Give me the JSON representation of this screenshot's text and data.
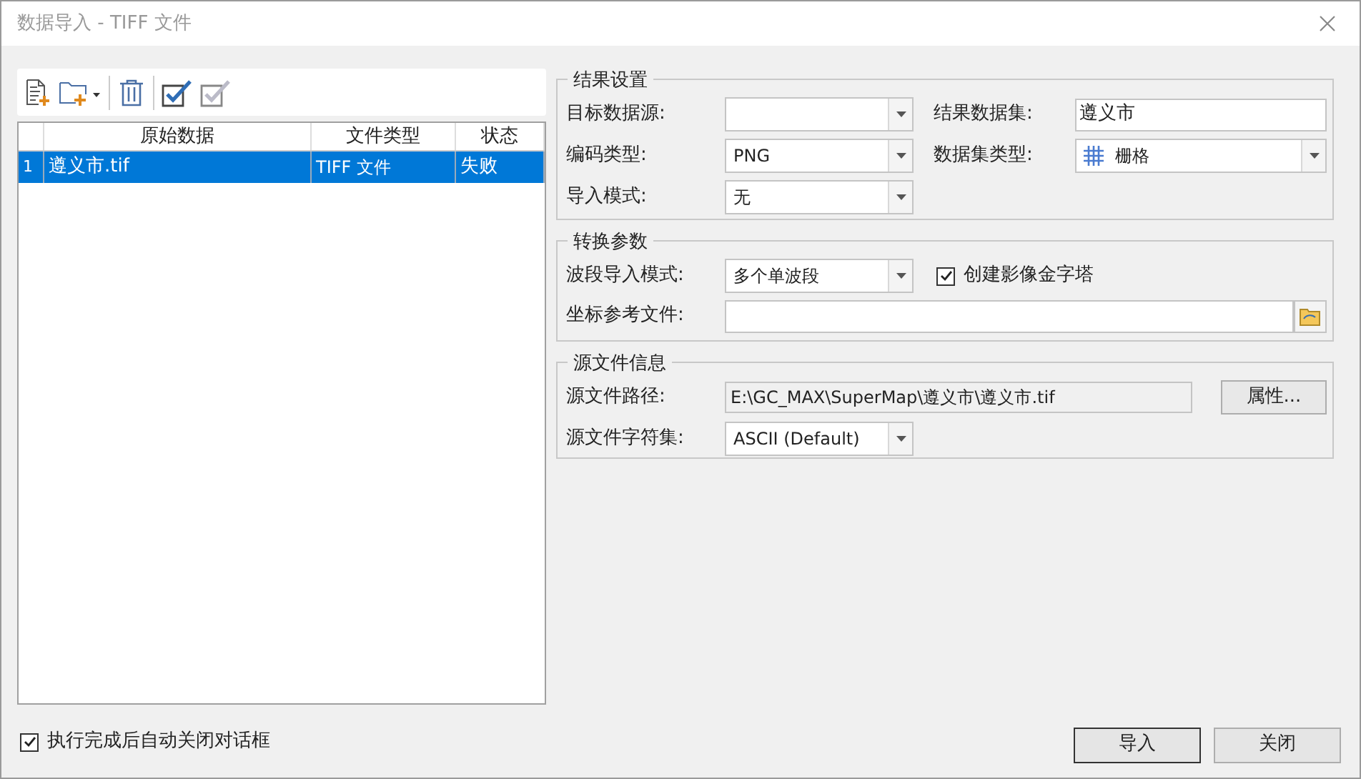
{
  "window": {
    "title": "数据导入 - TIFF 文件"
  },
  "toolbar": [
    {
      "kind": "add_file"
    },
    {
      "kind": "add_folder"
    },
    {
      "kind": "delete"
    },
    {
      "kind": "check_all"
    },
    {
      "kind": "check_none"
    }
  ],
  "table": {
    "columns": [
      "原始数据",
      "文件类型",
      "状态"
    ],
    "rows": [
      {
        "index": "1",
        "cells": [
          "遵义市.tif",
          "TIFF 文件",
          "失败"
        ],
        "selected": true
      }
    ]
  },
  "result_settings": {
    "title": "结果设置",
    "fields": [
      {
        "kind": "dropdown",
        "label": "目标数据源:"
      },
      {
        "kind": "text",
        "label": "结果数据集:",
        "value": "遵义市"
      },
      {
        "kind": "dropdown",
        "label": "编码类型:",
        "value": "PNG"
      },
      {
        "kind": "grid_dropdown",
        "label": "数据集类型:",
        "value": "栅格"
      },
      {
        "kind": "dropdown",
        "label": "导入模式:",
        "value": "无"
      }
    ]
  },
  "conversion": {
    "title": "转换参数",
    "band_mode": {
      "label": "波段导入模式:",
      "value": "多个单波段"
    },
    "pyramid": {
      "label": "创建影像金字塔",
      "checked": true
    },
    "reference_file": {
      "label": "坐标参考文件:"
    }
  },
  "source_info": {
    "title": "源文件信息",
    "path": {
      "label": "源文件路径:",
      "value": "E:\\GC_MAX\\SuperMap\\遵义市\\遵义市.tif"
    },
    "properties_button": "属性...",
    "charset": {
      "label": "源文件字符集:",
      "value": "ASCII (Default)"
    }
  },
  "footer": {
    "auto_close": {
      "label": "执行完成后自动关闭对话框",
      "checked": true
    },
    "buttons": [
      {
        "label": "导入",
        "default": true
      },
      {
        "label": "关闭",
        "default": false
      }
    ]
  }
}
